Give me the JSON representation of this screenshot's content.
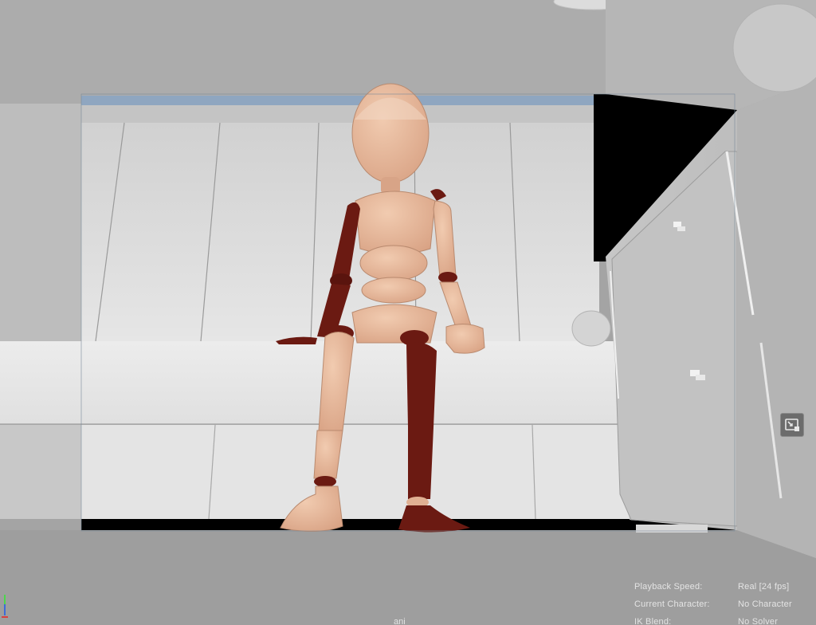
{
  "hud": {
    "playback_speed_label": "Playback Speed:",
    "playback_speed_value": "Real [24 fps]",
    "current_character_label": "Current Character:",
    "current_character_value": "No Character",
    "ik_blend_label": "IK Blend:",
    "ik_blend_value": "No Solver"
  },
  "camera": {
    "name": "ani"
  },
  "icons": {
    "gate_toggle": "resolution-gate-icon",
    "axis": "view-axis-gizmo-icon"
  },
  "colors": {
    "skin": "#e8b99b",
    "left_limbs": "#6b1a12",
    "room": "#d6d6d6",
    "gate_border": "#000000",
    "hud_text": "#e4e4e4"
  }
}
